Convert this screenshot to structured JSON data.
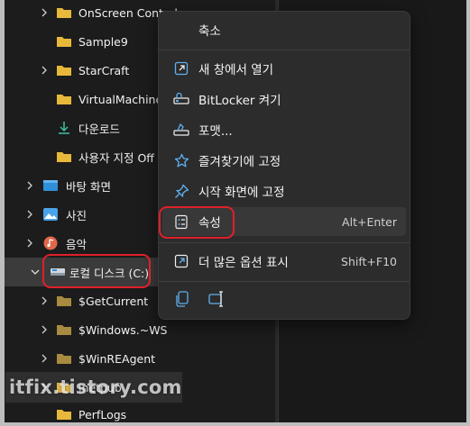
{
  "tree": {
    "items": [
      {
        "label": "OnScreen Control",
        "icon": "folder-icon"
      },
      {
        "label": "Sample9",
        "icon": "folder-icon"
      },
      {
        "label": "StarCraft",
        "icon": "folder-icon"
      },
      {
        "label": "VirtualMachine",
        "icon": "folder-icon"
      },
      {
        "label": "다운로드",
        "icon": "download-icon"
      },
      {
        "label": "사용자 지정 Off",
        "icon": "folder-icon"
      },
      {
        "label": "바탕 화면",
        "icon": "desktop-icon"
      },
      {
        "label": "사진",
        "icon": "pictures-icon"
      },
      {
        "label": "음악",
        "icon": "music-icon"
      },
      {
        "label": "로컬 디스크 (C:)",
        "icon": "drive-icon"
      },
      {
        "label": "$GetCurrent",
        "icon": "folder-icon"
      },
      {
        "label": "$Windows.~WS",
        "icon": "folder-icon"
      },
      {
        "label": "$WinREAgent",
        "icon": "folder-icon"
      },
      {
        "label": "inetpub",
        "icon": "folder-icon"
      },
      {
        "label": "PerfLogs",
        "icon": "folder-icon"
      }
    ]
  },
  "context_menu": {
    "items": [
      {
        "label": "축소",
        "icon": "",
        "shortcut": ""
      },
      {
        "label": "새 창에서 열기",
        "icon": "open-new-window-icon",
        "shortcut": ""
      },
      {
        "label": "BitLocker 켜기",
        "icon": "bitlocker-icon",
        "shortcut": ""
      },
      {
        "label": "포맷...",
        "icon": "format-icon",
        "shortcut": ""
      },
      {
        "label": "즐겨찾기에 고정",
        "icon": "star-icon",
        "shortcut": ""
      },
      {
        "label": "시작 화면에 고정",
        "icon": "pin-icon",
        "shortcut": ""
      },
      {
        "label": "속성",
        "icon": "properties-icon",
        "shortcut": "Alt+Enter"
      },
      {
        "label": "더 많은 옵션 표시",
        "icon": "more-options-icon",
        "shortcut": "Shift+F10"
      }
    ],
    "bottom_icons": [
      "copy-icon",
      "rename-icon"
    ]
  },
  "watermark": "itfix.tistory.com",
  "colors": {
    "folder": "#e8b83a",
    "accent": "#60b0f0",
    "highlight_box": "#e0202a"
  }
}
